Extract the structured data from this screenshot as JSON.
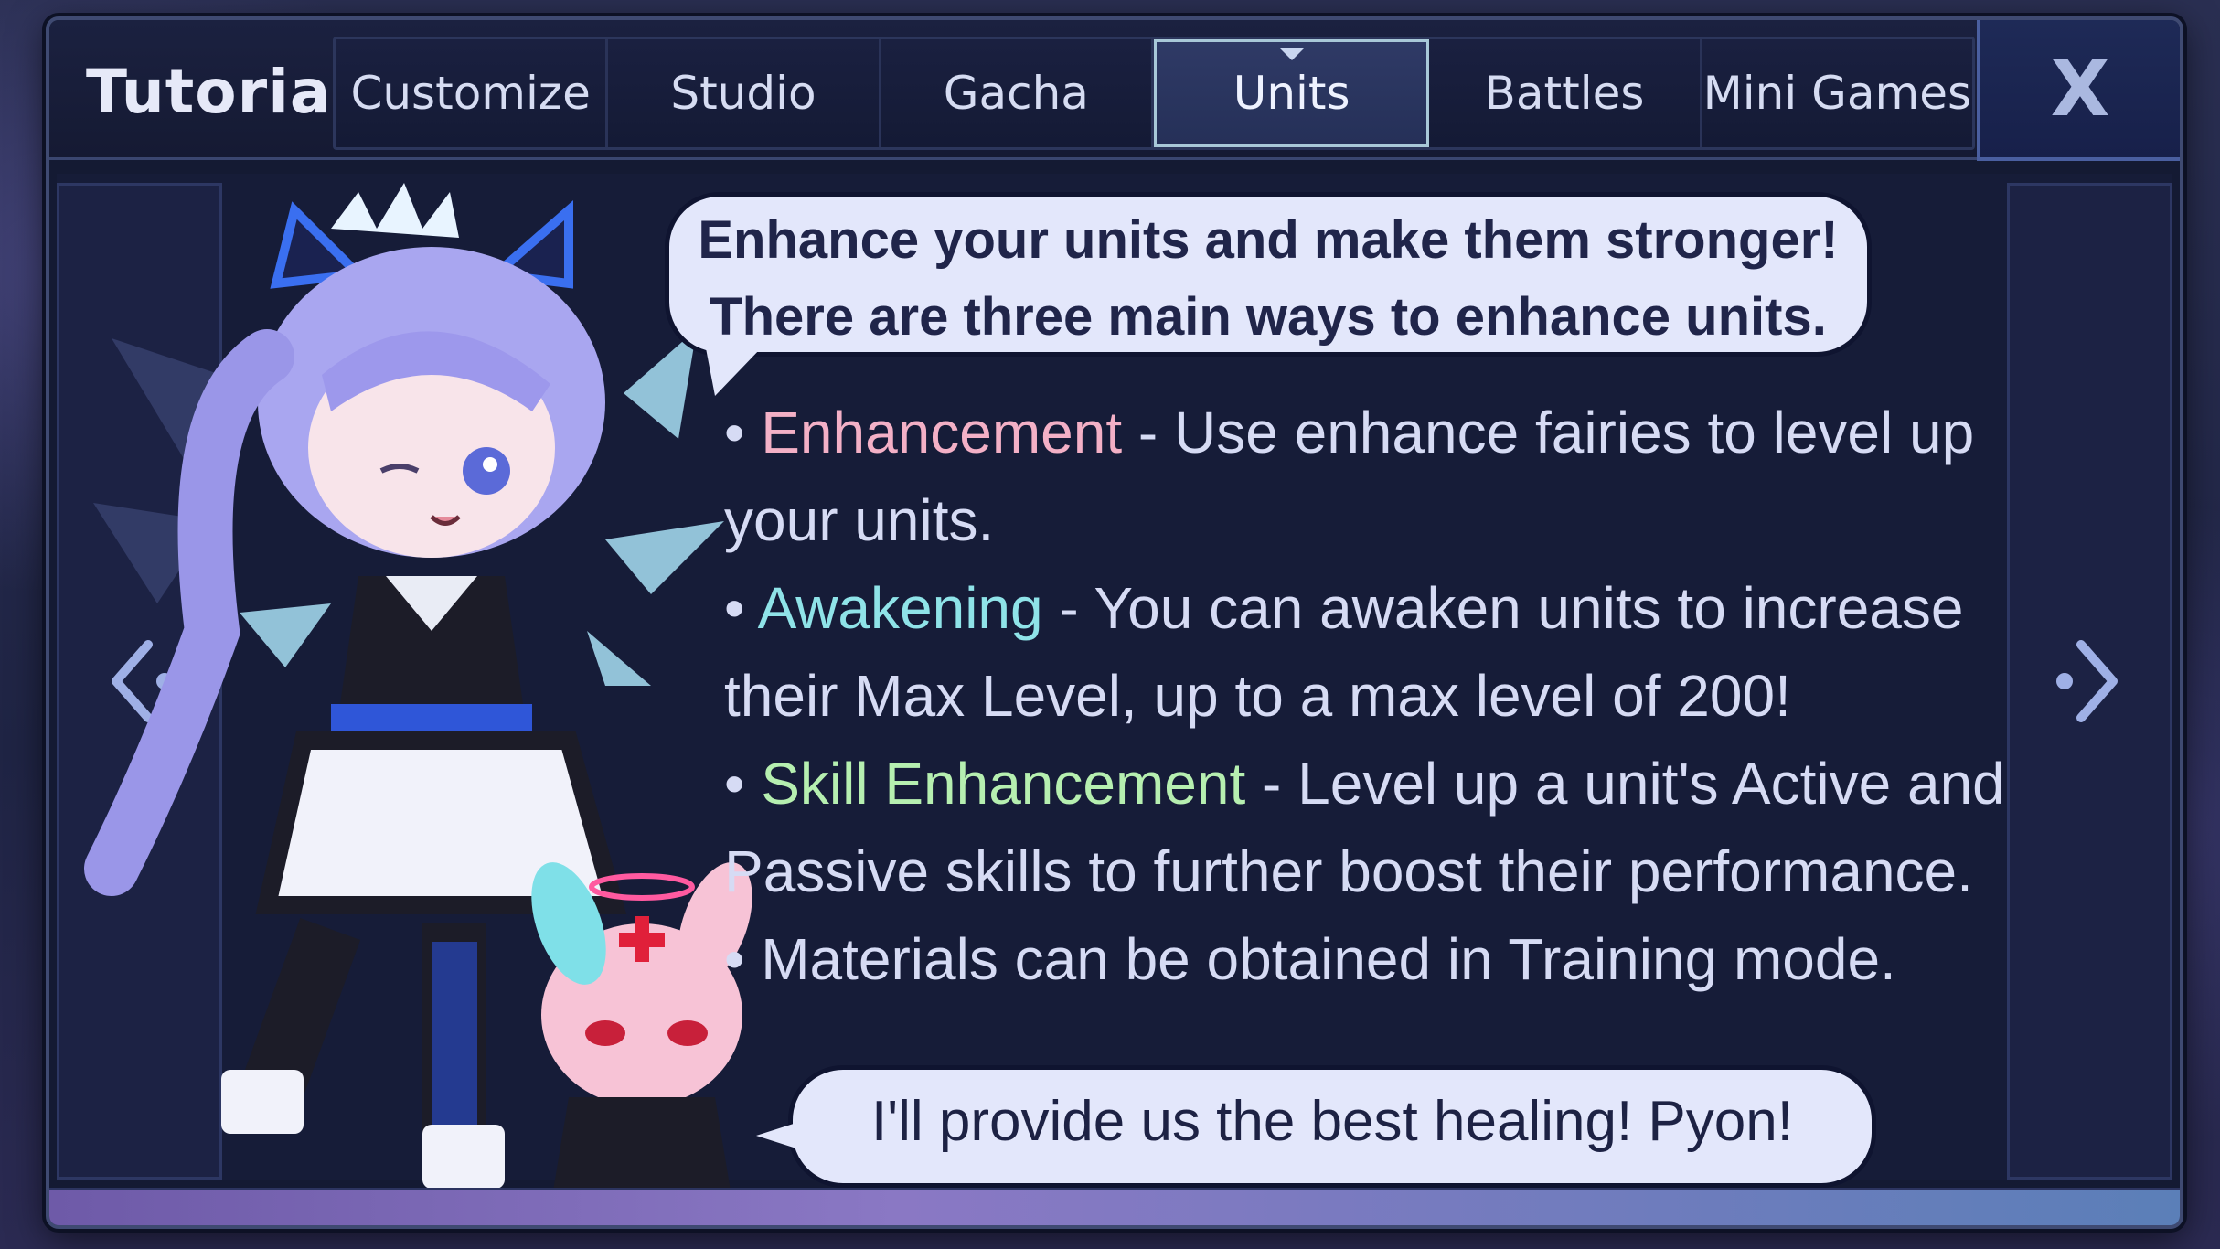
{
  "header": {
    "title": "Tutorial",
    "tabs": [
      {
        "label": "Customize",
        "active": false
      },
      {
        "label": "Studio",
        "active": false
      },
      {
        "label": "Gacha",
        "active": false
      },
      {
        "label": "Units",
        "active": true
      },
      {
        "label": "Battles",
        "active": false
      },
      {
        "label": "Mini Games",
        "active": false
      }
    ],
    "close_label": "X"
  },
  "tutorial": {
    "intro_line1": "Enhance your units and make them stronger!",
    "intro_line2": "There are three main ways to enhance units.",
    "bullets": [
      {
        "keyword": "Enhancement",
        "text": " - Use enhance fairies to level up your units.",
        "color": "#f3b0c6"
      },
      {
        "keyword": "Awakening",
        "text": " - You can awaken units to increase their Max Level, up to a max level of 200!",
        "color": "#8fe3e8"
      },
      {
        "keyword": "Skill Enhancement",
        "text": " - Level up a unit's Active and Passive skills to further boost their performance.",
        "color": "#b6efb0"
      },
      {
        "keyword": "",
        "text": "Materials can be obtained in Training mode.",
        "color": "#d6dbf4"
      }
    ],
    "bunny_quote": "I'll provide us the best healing! Pyon!"
  },
  "icons": {
    "prev": "chevron-left-icon",
    "next": "chevron-right-icon",
    "close": "close-icon"
  }
}
